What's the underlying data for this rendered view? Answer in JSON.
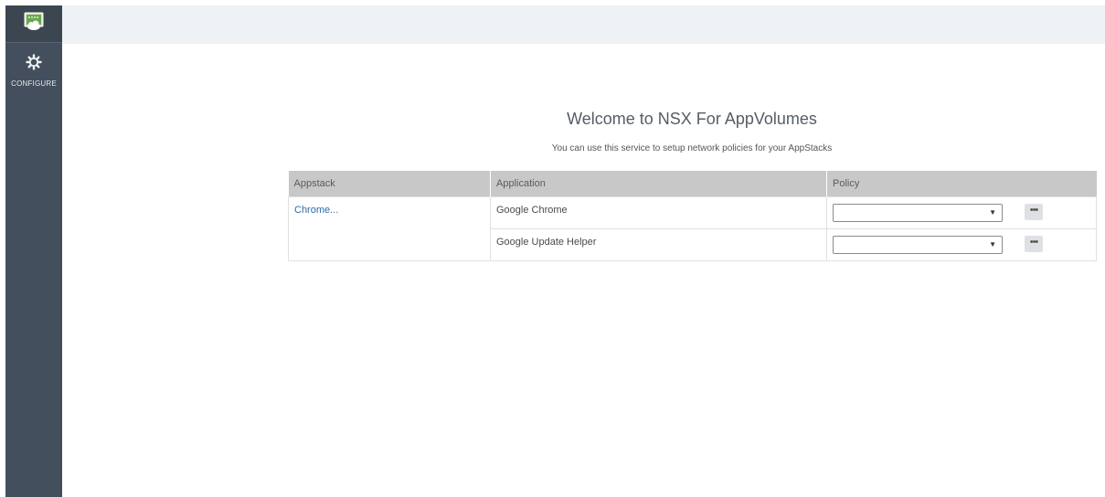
{
  "sidebar": {
    "logo_icon": "monitor-cloud-icon",
    "items": [
      {
        "label": "CONFIGURE",
        "icon": "gear-icon"
      }
    ],
    "colors": {
      "background": "#434f5c",
      "text": "#e4e8eb"
    }
  },
  "main": {
    "title": "Welcome to NSX For AppVolumes",
    "subtitle": "You can use this service to setup network policies for your AppStacks",
    "table": {
      "headers": [
        "Appstack",
        "Application",
        "Policy"
      ],
      "appstack": "Chrome...",
      "rows": [
        {
          "application": "Google Chrome",
          "policy": ""
        },
        {
          "application": "Google Update Helper",
          "policy": ""
        }
      ],
      "more_label": "•••"
    },
    "colors": {
      "link": "#2f6ba5",
      "header_bg": "#c8c8c8"
    }
  }
}
